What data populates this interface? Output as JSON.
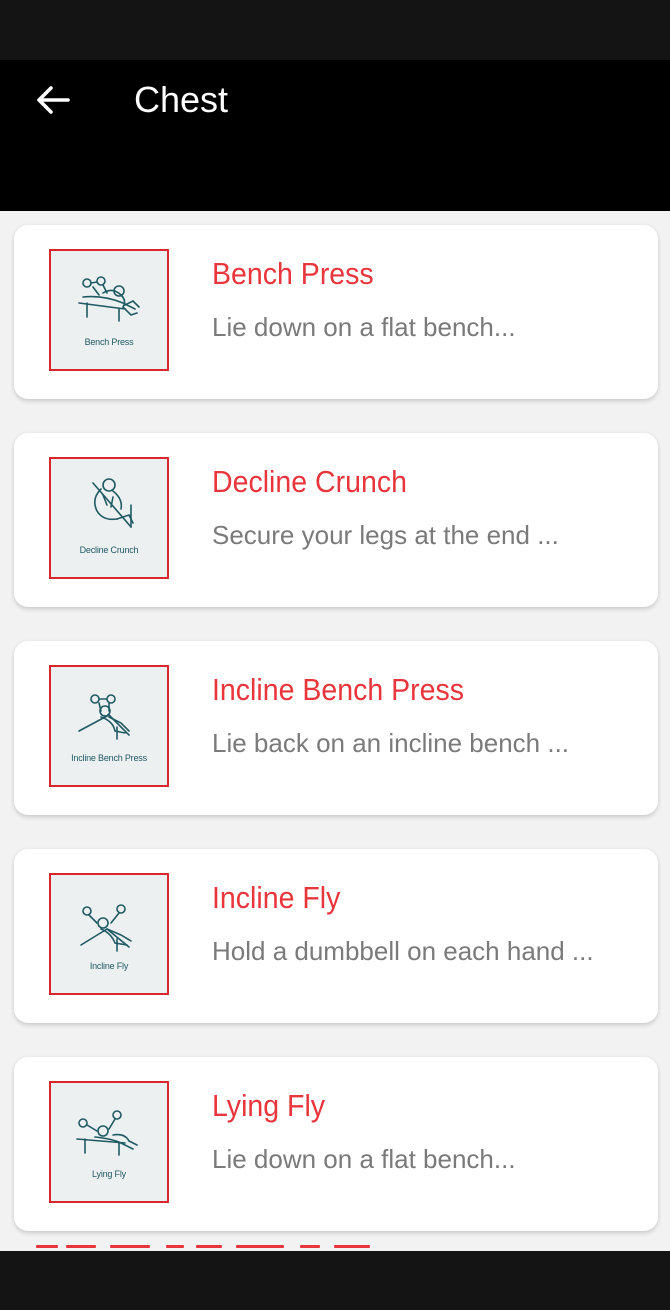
{
  "header": {
    "title": "Chest"
  },
  "exercises": [
    {
      "name": "Bench Press",
      "description": "Lie down on a flat bench...",
      "thumb_caption": "Bench Press"
    },
    {
      "name": "Decline Crunch",
      "description": "Secure your legs at the end ...",
      "thumb_caption": "Decline Crunch"
    },
    {
      "name": "Incline Bench Press",
      "description": "Lie back on an incline bench ...",
      "thumb_caption": "Incline Bench Press"
    },
    {
      "name": "Incline Fly",
      "description": "Hold a dumbbell on each hand ...",
      "thumb_caption": "Incline Fly"
    },
    {
      "name": "Lying Fly",
      "description": "Lie down on a flat bench...",
      "thumb_caption": "Lying Fly"
    }
  ],
  "colors": {
    "accent": "#e8363c",
    "app_bar": "#000000",
    "background": "#f2f2f2",
    "description": "#7a7a7a",
    "thumb_ink": "#1f5a63"
  },
  "icons": {
    "back": "arrow-left-icon",
    "thumbnail": "exercise-illustration-icon"
  }
}
